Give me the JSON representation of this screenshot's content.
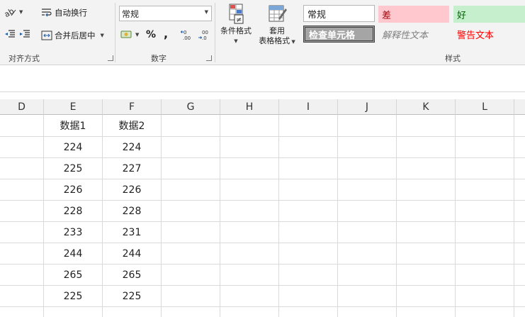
{
  "ribbon": {
    "alignment_group": {
      "label": "对齐方式",
      "wrap_text": "自动换行",
      "merge_center": "合并后居中"
    },
    "number_group": {
      "label": "数字",
      "format_value": "常规",
      "percent": "%",
      "comma": ","
    },
    "cond_format": "条件格式",
    "table_format_line1": "套用",
    "table_format_line2": "表格格式",
    "styles_group": {
      "label": "样式",
      "normal": "常规",
      "bad": "差",
      "good": "好",
      "check_cell": "检查单元格",
      "explanatory": "解释性文本",
      "warning": "警告文本",
      "colors": {
        "bad_bg": "#ffc7ce",
        "bad_fg": "#9c0006",
        "good_bg": "#c6efce",
        "good_fg": "#006100",
        "check_bg": "#a5a5a5",
        "warning_fg": "#ff0000",
        "explanatory_fg": "#7f7f7f"
      }
    }
  },
  "sheet": {
    "columns": [
      "D",
      "E",
      "F",
      "G",
      "H",
      "I",
      "J",
      "K",
      "L"
    ],
    "header_row": [
      "数据1",
      "数据2"
    ],
    "rows": [
      [
        "224",
        "224"
      ],
      [
        "225",
        "227"
      ],
      [
        "226",
        "226"
      ],
      [
        "228",
        "228"
      ],
      [
        "233",
        "231"
      ],
      [
        "244",
        "244"
      ],
      [
        "265",
        "265"
      ],
      [
        "225",
        "225"
      ]
    ]
  }
}
